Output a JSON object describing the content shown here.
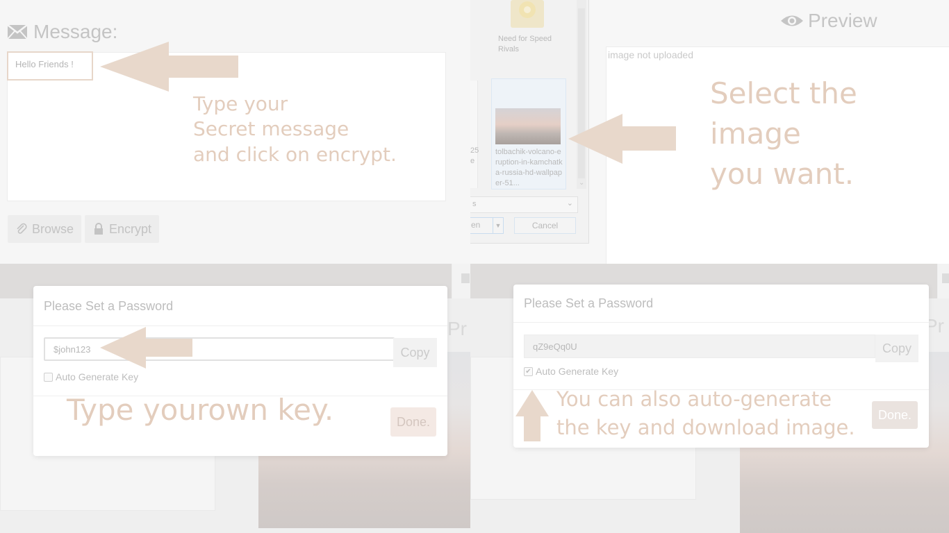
{
  "message_panel": {
    "heading": "Message:",
    "message_text": "Hello Friends !",
    "browse_label": "Browse",
    "encrypt_label": "Encrypt",
    "annotation": [
      "Type your",
      "Secret message",
      "and click on encrypt."
    ]
  },
  "file_dialog": {
    "folder_label": "Need for Speed Rivals",
    "selected_file_label": "tolbachik-volcano-eruption-in-kamchatka-russia-hd-wallpaper-51...",
    "partial_texts": [
      "25",
      "e"
    ],
    "type_select_partial": "s",
    "open_label_partial": "en",
    "cancel_label": "Cancel",
    "annotation": [
      "Select the image",
      "you want."
    ]
  },
  "preview_panel": {
    "heading": "Preview",
    "image_alt": "image not uploaded",
    "background_heading_partial": "Pr"
  },
  "password_modal_manual": {
    "title": "Please Set a Password",
    "key_value": "$john123",
    "copy_label": "Copy",
    "auto_generate_label": "Auto Generate Key",
    "auto_generate_checked": false,
    "done_label": "Done.",
    "annotation": "Type yourown key."
  },
  "password_modal_auto": {
    "title": "Please Set a Password",
    "key_value": "qZ9eQq0U",
    "copy_label": "Copy",
    "auto_generate_label": "Auto Generate Key",
    "auto_generate_checked": true,
    "check_mark": "✔",
    "done_label": "Done.",
    "annotation": [
      "You can also auto-generate",
      "the key and download image."
    ]
  },
  "colors": {
    "annotation": "#e3cdbd",
    "arrow": "#e8d8cb",
    "overlay_band": "#dedcdb"
  }
}
